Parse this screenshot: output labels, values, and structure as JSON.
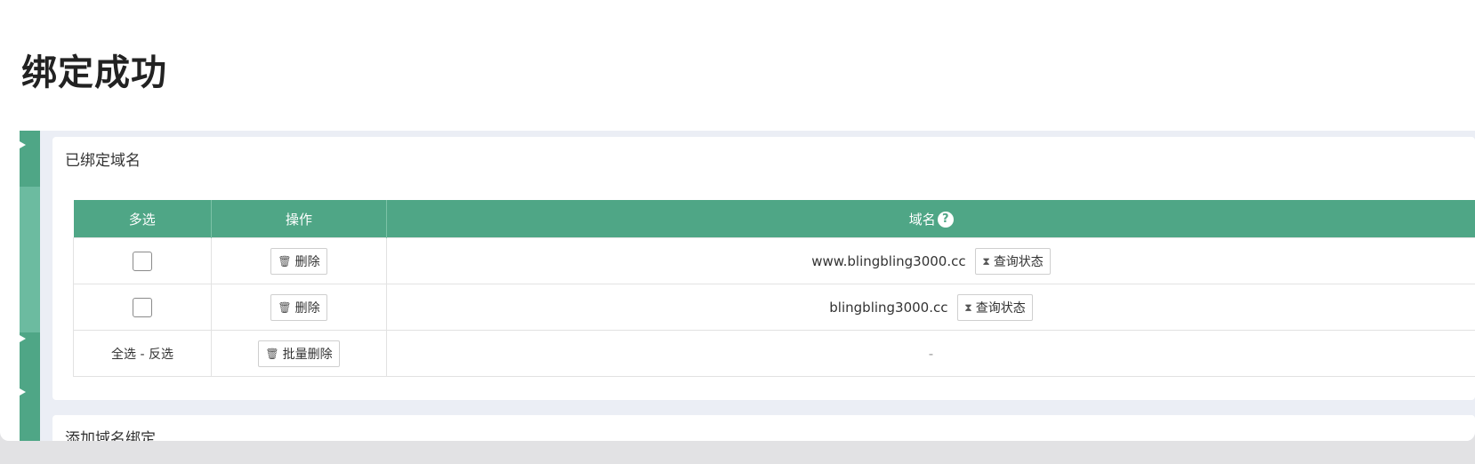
{
  "page": {
    "title": "绑定成功"
  },
  "bound_panel": {
    "title": "已绑定域名",
    "columns": {
      "multi_select": "多选",
      "action": "操作",
      "domain": "域名"
    },
    "rows": [
      {
        "delete_label": "删除",
        "domain": "www.blingbling3000.cc",
        "status_label": "查询状态"
      },
      {
        "delete_label": "删除",
        "domain": "blingbling3000.cc",
        "status_label": "查询状态"
      }
    ],
    "footer": {
      "select_all": "全选",
      "separator": "-",
      "invert_select": "反选",
      "batch_delete_label": "批量删除",
      "domain_placeholder": "-"
    }
  },
  "add_panel": {
    "title": "添加域名绑定"
  },
  "icons": {
    "help": "?",
    "trash": "trash-icon",
    "hourglass": "hourglass-icon"
  },
  "colors": {
    "accent": "#4fa686",
    "accent_light": "#6cbba0",
    "content_bg": "#ebeef5"
  }
}
